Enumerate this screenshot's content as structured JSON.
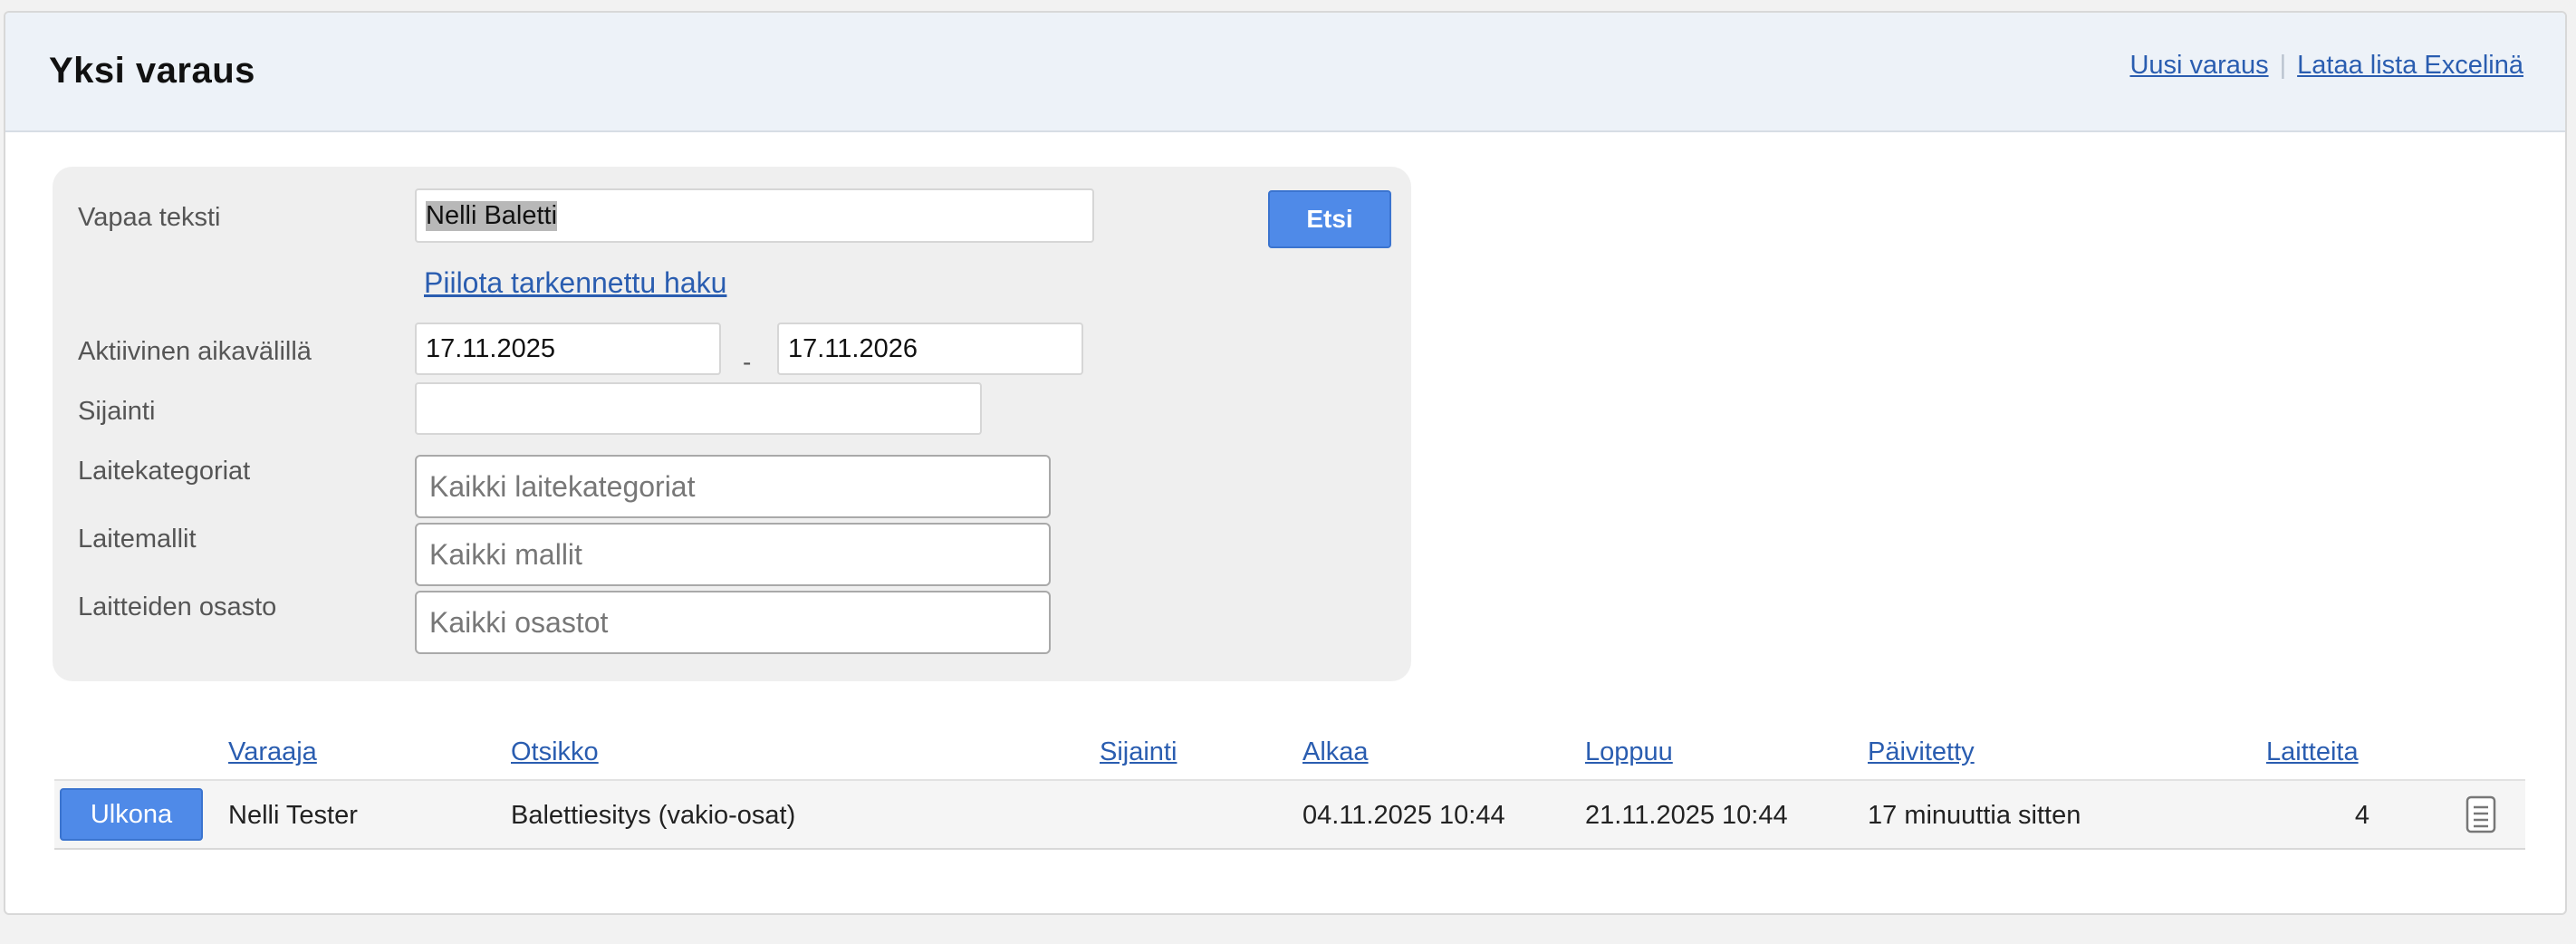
{
  "header": {
    "title": "Yksi varaus",
    "new_reservation": "Uusi varaus",
    "separator": "|",
    "download_excel": "Lataa lista Excelinä"
  },
  "search": {
    "free_text_label": "Vapaa teksti",
    "free_text_value": "Nelli Baletti",
    "search_button": "Etsi",
    "toggle_advanced": "Piilota tarkennettu haku",
    "active_range_label": "Aktiivinen aikavälillä",
    "range_start": "17.11.2025",
    "range_sep": "-",
    "range_end": "17.11.2026",
    "location_label": "Sijainti",
    "location_value": "",
    "categories_label": "Laitekategoriat",
    "categories_placeholder": "Kaikki laitekategoriat",
    "models_label": "Laitemallit",
    "models_placeholder": "Kaikki mallit",
    "department_label": "Laitteiden osasto",
    "department_placeholder": "Kaikki osastot"
  },
  "table": {
    "columns": {
      "booker": "Varaaja",
      "title": "Otsikko",
      "location": "Sijainti",
      "start": "Alkaa",
      "end": "Loppuu",
      "updated": "Päivitetty",
      "devices": "Laitteita"
    },
    "rows": [
      {
        "status": "Ulkona",
        "booker": "Nelli Tester",
        "title": "Balettiesitys (vakio-osat)",
        "location": "",
        "start": "04.11.2025 10:44",
        "end": "21.11.2025 10:44",
        "updated": "17 minuuttia sitten",
        "devices": "4",
        "icon": "document-icon"
      }
    ]
  },
  "colors": {
    "accent": "#4f8ae8",
    "link": "#2a5db0",
    "header_bg": "#edf2f8"
  }
}
